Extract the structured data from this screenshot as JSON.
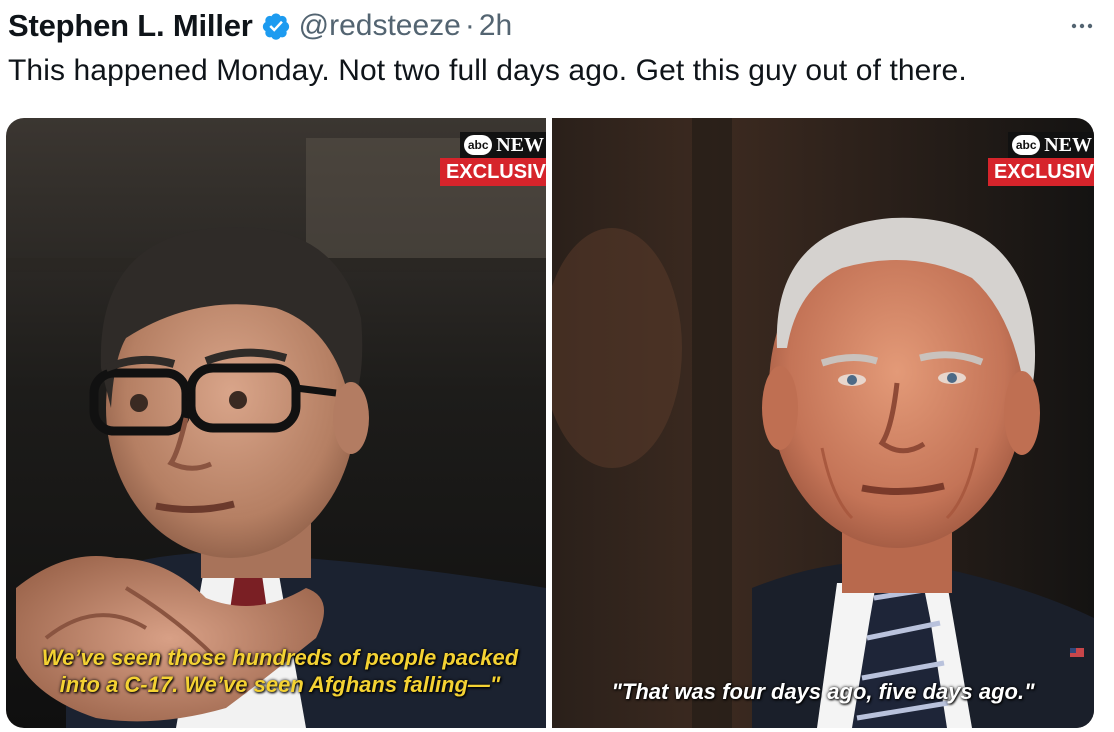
{
  "tweet": {
    "author": {
      "name": "Stephen L. Miller",
      "handle": "@redsteeze",
      "separator": "·",
      "time": "2h",
      "verified": true
    },
    "text": "This happened Monday. Not two full days ago. Get this guy out of there.",
    "icons": {
      "verified": "verified-badge-icon",
      "more": "more-options-icon"
    },
    "colors": {
      "verified_blue": "#1d9bf0",
      "secondary_text": "#536471",
      "primary_text": "#0f1419"
    }
  },
  "media": {
    "left": {
      "network": "NEW",
      "network_logo": "abc",
      "tag": "EXCLUSIV",
      "caption_line1": "We’ve seen those hundreds of people packed",
      "caption_line2": "into a C-17. We’ve seen Afghans falling—\"",
      "caption_color": "#f4d233"
    },
    "right": {
      "network": "NEW",
      "network_logo": "abc",
      "tag": "EXCLUSIV",
      "caption": "\"That was four days ago, five days ago.\"",
      "caption_color": "#ffffff"
    }
  }
}
